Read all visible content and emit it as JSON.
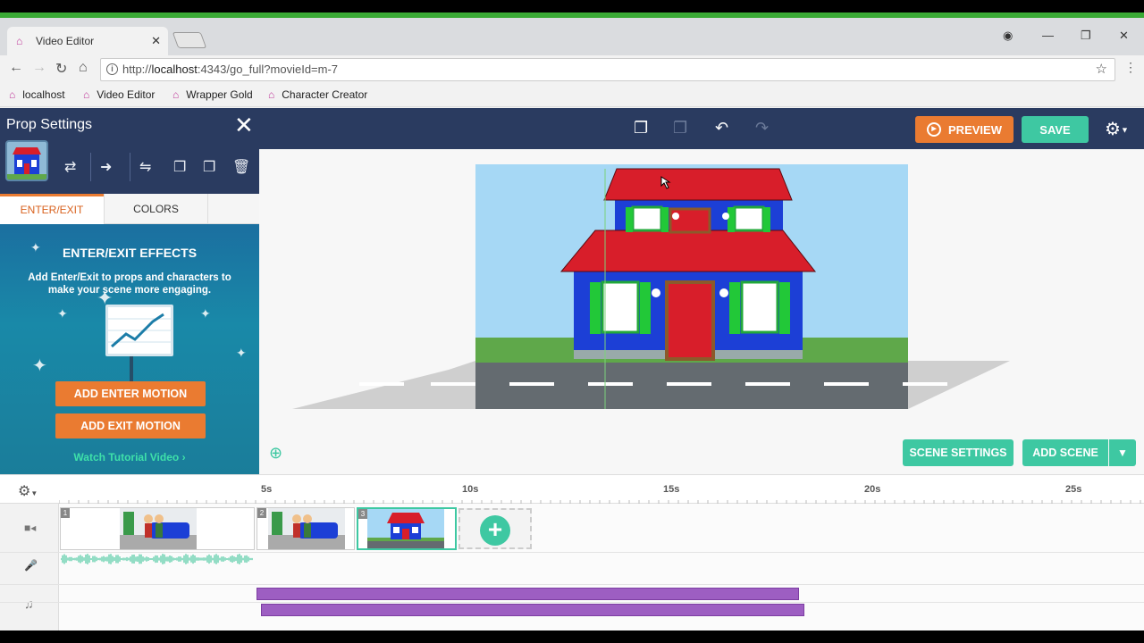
{
  "browser": {
    "tab_title": "Video Editor",
    "tab_close": "✕",
    "url_prefix": "http://",
    "url_host": "localhost",
    "url_rest": ":4343/go_full?movieId=m-7",
    "bookmarks": [
      {
        "label": "localhost"
      },
      {
        "label": "Video Editor"
      },
      {
        "label": "Wrapper Gold"
      },
      {
        "label": "Character Creator"
      }
    ]
  },
  "toolbar": {
    "preview_label": "PREVIEW",
    "save_label": "SAVE"
  },
  "prop_panel": {
    "title": "Prop Settings",
    "tabs": [
      {
        "label": "ENTER/EXIT",
        "active": true
      },
      {
        "label": "COLORS",
        "active": false
      }
    ],
    "effects_title": "ENTER/EXIT EFFECTS",
    "effects_desc": "Add Enter/Exit to props and characters to make your scene more engaging.",
    "add_enter_label": "ADD ENTER MOTION",
    "add_exit_label": "ADD EXIT MOTION",
    "tutorial_label": "Watch Tutorial Video"
  },
  "stage": {
    "scene_settings_label": "SCENE SETTINGS",
    "add_scene_label": "ADD SCENE"
  },
  "timeline": {
    "ticks": [
      "5s",
      "10s",
      "15s",
      "20s",
      "25s"
    ],
    "scenes": [
      {
        "number": "1",
        "selected": false
      },
      {
        "number": "2",
        "selected": false
      },
      {
        "number": "3",
        "selected": true
      }
    ]
  },
  "colors": {
    "accent_orange": "#ea7b31",
    "accent_green": "#3ec8a2",
    "navy": "#2a3b60",
    "music_purple": "#9d5ec2"
  }
}
